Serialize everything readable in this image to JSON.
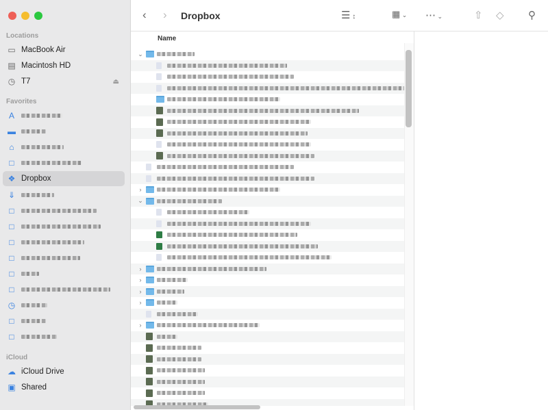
{
  "window": {
    "title": "Dropbox"
  },
  "sidebar": {
    "sections": [
      {
        "label": "Locations",
        "items": [
          {
            "label": "MacBook Air",
            "icon": "laptop-icon"
          },
          {
            "label": "Macintosh HD",
            "icon": "disk-icon"
          },
          {
            "label": "T7",
            "icon": "time-machine-icon",
            "eject": true
          }
        ]
      },
      {
        "label": "Favorites",
        "items": [
          {
            "label": "",
            "icon": "apps-icon"
          },
          {
            "label": "",
            "icon": "desktop-icon"
          },
          {
            "label": "",
            "icon": "home-icon"
          },
          {
            "label": "",
            "icon": "folder-icon"
          },
          {
            "label": "Dropbox",
            "icon": "dropbox-icon",
            "selected": true
          },
          {
            "label": "",
            "icon": "download-icon"
          },
          {
            "label": "",
            "icon": "folder-icon"
          },
          {
            "label": "",
            "icon": "folder-icon"
          },
          {
            "label": "",
            "icon": "folder-icon"
          },
          {
            "label": "",
            "icon": "folder-icon"
          },
          {
            "label": "",
            "icon": "folder-icon"
          },
          {
            "label": "",
            "icon": "folder-icon"
          },
          {
            "label": "",
            "icon": "clock-icon"
          },
          {
            "label": "",
            "icon": "folder-icon"
          },
          {
            "label": "",
            "icon": "folder-icon"
          }
        ]
      },
      {
        "label": "iCloud",
        "items": [
          {
            "label": "iCloud Drive",
            "icon": "cloud-icon"
          },
          {
            "label": "Shared",
            "icon": "shared-folder-icon"
          }
        ]
      }
    ]
  },
  "list": {
    "column_name": "Name",
    "rows": [
      {
        "level": 0,
        "disc": "open",
        "icon": "folder"
      },
      {
        "level": 1,
        "icon": "doc"
      },
      {
        "level": 1,
        "icon": "doc"
      },
      {
        "level": 1,
        "icon": "doc"
      },
      {
        "level": 1,
        "icon": "folder"
      },
      {
        "level": 1,
        "icon": "img"
      },
      {
        "level": 1,
        "icon": "img"
      },
      {
        "level": 1,
        "icon": "img"
      },
      {
        "level": 1,
        "icon": "doc"
      },
      {
        "level": 1,
        "icon": "img"
      },
      {
        "level": 0,
        "icon": "doc"
      },
      {
        "level": 0,
        "icon": "doc"
      },
      {
        "level": 0,
        "disc": "closed",
        "icon": "folder"
      },
      {
        "level": 0,
        "disc": "open",
        "icon": "folder"
      },
      {
        "level": 1,
        "icon": "doc"
      },
      {
        "level": 1,
        "icon": "doc"
      },
      {
        "level": 1,
        "icon": "green"
      },
      {
        "level": 1,
        "icon": "green"
      },
      {
        "level": 1,
        "icon": "doc"
      },
      {
        "level": 0,
        "disc": "closed",
        "icon": "folder"
      },
      {
        "level": 0,
        "disc": "closed",
        "icon": "folder"
      },
      {
        "level": 0,
        "disc": "closed",
        "icon": "folder"
      },
      {
        "level": 0,
        "disc": "closed",
        "icon": "folder"
      },
      {
        "level": 0,
        "icon": "doc"
      },
      {
        "level": 0,
        "disc": "closed",
        "icon": "folder"
      },
      {
        "level": 0,
        "icon": "img"
      },
      {
        "level": 0,
        "icon": "img"
      },
      {
        "level": 0,
        "icon": "img"
      },
      {
        "level": 0,
        "icon": "img"
      },
      {
        "level": 0,
        "icon": "img"
      },
      {
        "level": 0,
        "icon": "img"
      },
      {
        "level": 0,
        "icon": "img"
      }
    ]
  }
}
